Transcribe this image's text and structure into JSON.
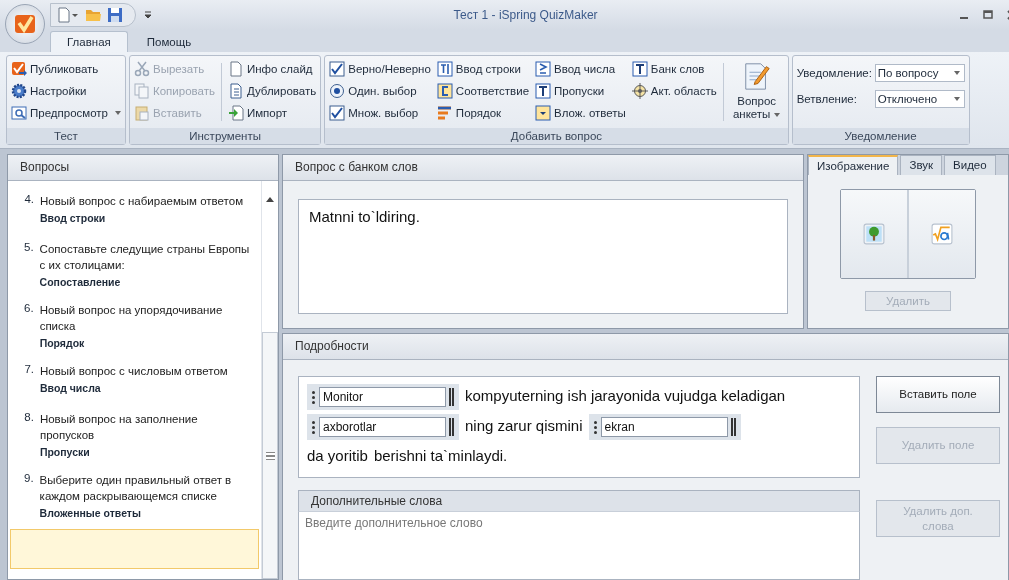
{
  "window": {
    "title": "Тест 1 - iSpring QuizMaker"
  },
  "ribbon_tabs": [
    {
      "label": "Главная",
      "selected": true
    },
    {
      "label": "Помощь",
      "selected": false
    }
  ],
  "ribbon": {
    "groups": [
      {
        "title": "Тест",
        "columns": [
          [
            {
              "label": "Публиковать",
              "disabled": false,
              "dropdown": false
            },
            {
              "label": "Настройки",
              "disabled": false,
              "dropdown": false
            },
            {
              "label": "Предпросмотр",
              "disabled": false,
              "dropdown": true
            }
          ]
        ]
      },
      {
        "title": "Инструменты",
        "columns": [
          [
            {
              "label": "Вырезать",
              "disabled": true,
              "dropdown": false
            },
            {
              "label": "Копировать",
              "disabled": true,
              "dropdown": false
            },
            {
              "label": "Вставить",
              "disabled": true,
              "dropdown": false
            }
          ],
          [
            {
              "label": "Инфо слайд",
              "disabled": false,
              "dropdown": false
            },
            {
              "label": "Дублировать",
              "disabled": false,
              "dropdown": false
            },
            {
              "label": "Импорт",
              "disabled": false,
              "dropdown": false
            }
          ]
        ]
      },
      {
        "title": "Добавить вопрос",
        "columns": [
          [
            {
              "label": "Верно/Неверно",
              "disabled": false,
              "dropdown": false
            },
            {
              "label": "Один. выбор",
              "disabled": false,
              "dropdown": false
            },
            {
              "label": "Множ. выбор",
              "disabled": false,
              "dropdown": false
            }
          ],
          [
            {
              "label": "Ввод строки",
              "disabled": false,
              "dropdown": false
            },
            {
              "label": "Соответствие",
              "disabled": false,
              "dropdown": false
            },
            {
              "label": "Порядок",
              "disabled": false,
              "dropdown": false
            }
          ],
          [
            {
              "label": "Ввод числа",
              "disabled": false,
              "dropdown": false
            },
            {
              "label": "Пропуски",
              "disabled": false,
              "dropdown": false
            },
            {
              "label": "Влож. ответы",
              "disabled": false,
              "dropdown": false
            }
          ],
          [
            {
              "label": "Банк слов",
              "disabled": false,
              "dropdown": false
            },
            {
              "label": "Акт. область",
              "disabled": false,
              "dropdown": false
            }
          ]
        ],
        "big_button": {
          "label": "Вопрос анкеты",
          "dropdown": true
        }
      },
      {
        "title": "Уведомление",
        "fields": [
          {
            "label": "Уведомление:",
            "value": "По вопросу"
          },
          {
            "label": "Ветвление:",
            "value": "Отключено"
          }
        ]
      }
    ]
  },
  "questions": {
    "title": "Вопросы",
    "items": [
      {
        "number": "4.",
        "text": "Новый вопрос с набираемым ответом",
        "type": "Ввод строки",
        "selected": false
      },
      {
        "number": "5.",
        "text": "Сопоставьте следущие страны Европы с их столицами:",
        "type": "Сопоставление",
        "selected": false
      },
      {
        "number": "6.",
        "text": "Новый вопрос на упорядочивание списка",
        "type": "Порядок",
        "selected": false
      },
      {
        "number": "7.",
        "text": "Новый вопрос с числовым ответом",
        "type": "Ввод числа",
        "selected": false
      },
      {
        "number": "8.",
        "text": "Новый вопрос на заполнение пропусков",
        "type": "Пропуски",
        "selected": false
      },
      {
        "number": "9.",
        "text": "Выберите один правильный ответ в каждом раскрывающемся списке",
        "type": "Вложенные ответы",
        "selected": false
      },
      {
        "selected": true
      }
    ]
  },
  "question_panel": {
    "title": "Вопрос с банком слов",
    "text": "Matnni to`ldiring."
  },
  "media_panel": {
    "tabs": [
      {
        "label": "Изображение",
        "selected": true
      },
      {
        "label": "Звук",
        "selected": false
      },
      {
        "label": "Видео",
        "selected": false
      }
    ],
    "delete_button": {
      "label": "Удалить",
      "disabled": true
    }
  },
  "details": {
    "title": "Подробности",
    "content": [
      {
        "kind": "field",
        "value": "Monitor"
      },
      {
        "kind": "text",
        "text": "kompyuterning ish jarayonida vujudga keladigan"
      },
      {
        "kind": "field",
        "value": "axborotlar"
      },
      {
        "kind": "text",
        "text": "ning zarur qismini"
      },
      {
        "kind": "field",
        "value": "ekran"
      },
      {
        "kind": "text",
        "text": "da yoritib"
      },
      {
        "kind": "text",
        "text": "berishni ta`minlaydi."
      }
    ],
    "extra_words": {
      "title": "Дополнительные слова",
      "placeholder": "Введите дополнительное слово"
    },
    "buttons": [
      {
        "label": "Вставить поле",
        "disabled": false
      },
      {
        "label": "Удалить поле",
        "disabled": true
      },
      {
        "label": "Удалить доп. слова",
        "disabled": true
      }
    ]
  }
}
